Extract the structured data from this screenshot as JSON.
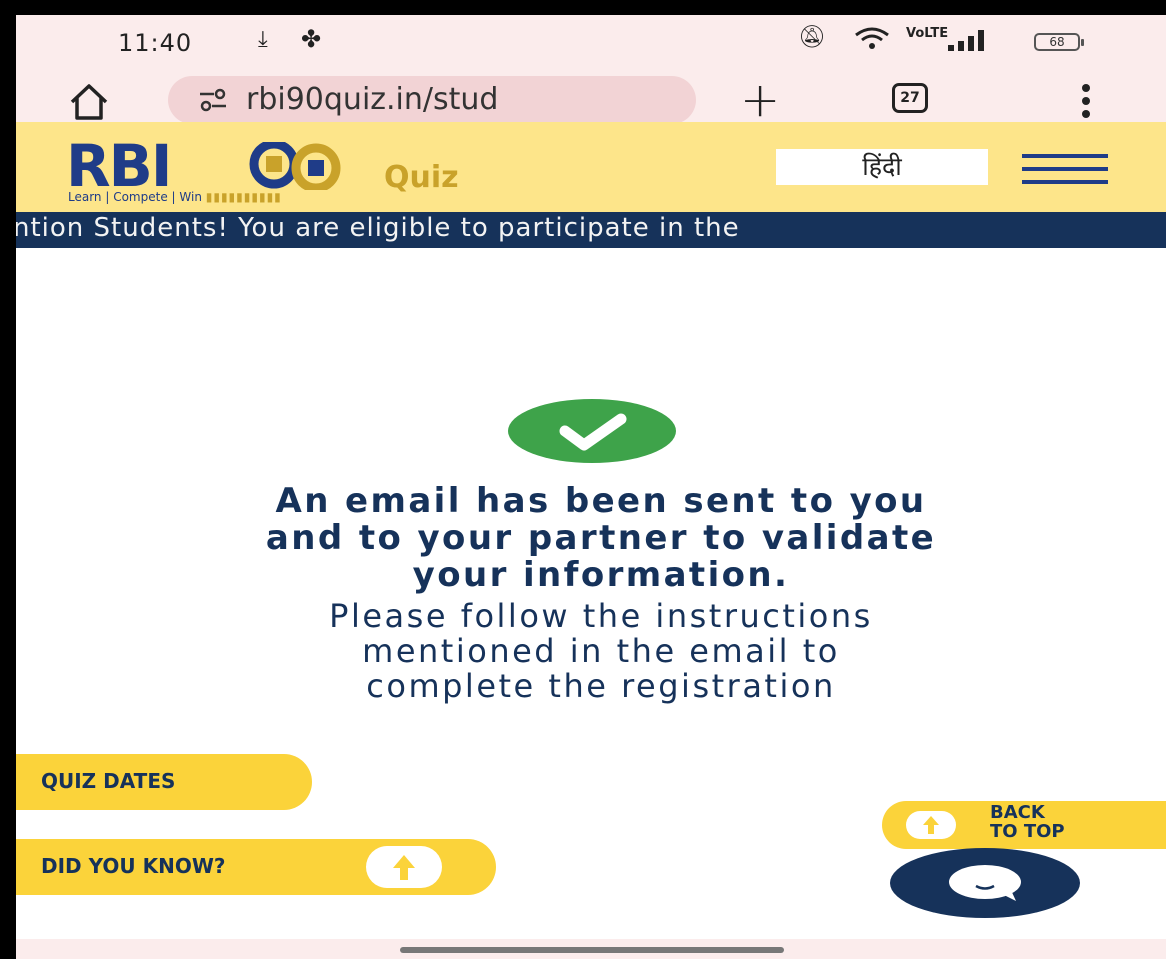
{
  "status_bar": {
    "time": "11:40",
    "network_label": "VoLTE",
    "battery": "68"
  },
  "browser": {
    "url": "rbi90quiz.in/stud",
    "tab_count": "27"
  },
  "header": {
    "logo_main": "RBI",
    "logo_suffix": "Quiz",
    "logo_tagline": "Learn | Compete | Win",
    "language_button": "हिंदी"
  },
  "ticker": {
    "text": "ention Students! You are eligible to participate in the"
  },
  "confirmation": {
    "heading_line1": "An email has been sent to you",
    "heading_line2": "and to your partner to validate",
    "heading_line3": "your information.",
    "sub_line1": "Please follow the instructions",
    "sub_line2": "mentioned in the email to",
    "sub_line3": "complete the registration"
  },
  "floating": {
    "quiz_dates": "QUIZ DATES",
    "did_you_know": "DID YOU KNOW?",
    "back_line1": "BACK",
    "back_line2": "TO TOP"
  },
  "colors": {
    "brand_navy": "#16325a",
    "brand_yellow": "#fbd33a",
    "header_yellow": "#fde58a",
    "success_green": "#3ea34a"
  }
}
